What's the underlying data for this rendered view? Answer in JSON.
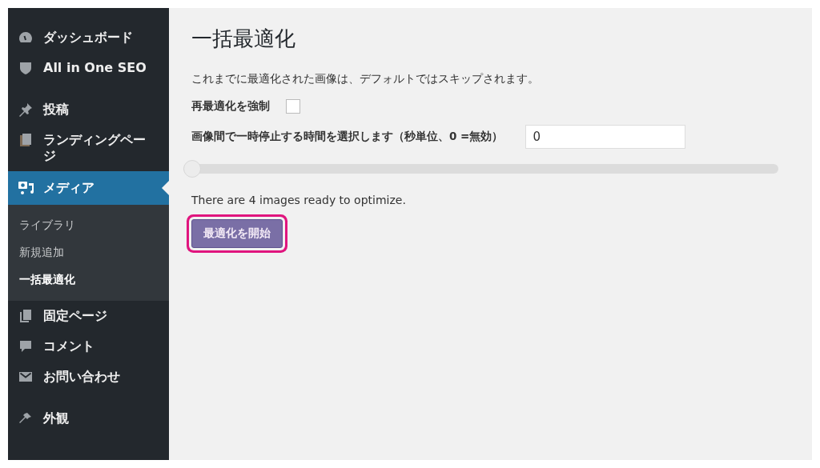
{
  "sidebar": {
    "groups": [
      [
        {
          "label": "ダッシュボード",
          "selected": false
        },
        {
          "label": "All in One SEO",
          "selected": false
        }
      ],
      [
        {
          "label": "投稿",
          "selected": false
        },
        {
          "label": "ランディングページ",
          "selected": false
        },
        {
          "label": "メディア",
          "selected": true,
          "children": [
            {
              "label": "ライブラリ",
              "selected": false
            },
            {
              "label": "新規追加",
              "selected": false
            },
            {
              "label": "一括最適化",
              "selected": true
            }
          ]
        },
        {
          "label": "固定ページ",
          "selected": false
        },
        {
          "label": "コメント",
          "selected": false
        },
        {
          "label": "お問い合わせ",
          "selected": false
        }
      ],
      [
        {
          "label": "外観",
          "selected": false
        }
      ]
    ]
  },
  "page": {
    "title": "一括最適化",
    "description": "これまでに最適化された画像は、デフォルトではスキップされます。",
    "force_label": "再最適化を強制",
    "force_checked": false,
    "pause_label": "画像間で一時停止する時間を選択します（秒単位、0 =無効）",
    "pause_value": "0",
    "slider": {
      "level": 0
    },
    "status": "There are 4 images ready to optimize.",
    "start_button": "最適化を開始"
  }
}
